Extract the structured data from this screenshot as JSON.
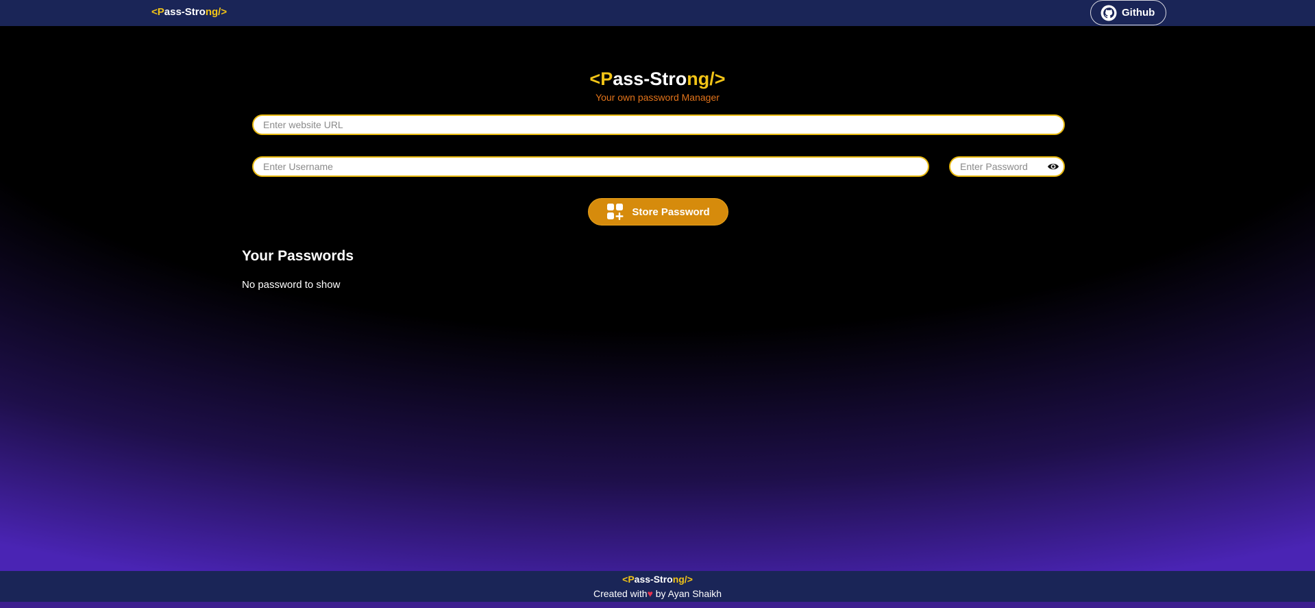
{
  "nav": {
    "logo": {
      "open": "<",
      "p": "P",
      "a": "a",
      "ss": "ss-Stro",
      "ng": "ng/",
      "close": ">"
    },
    "github_label": "Github"
  },
  "hero": {
    "title": {
      "open": "<",
      "p": "P",
      "a": "a",
      "ss": "ss-Stro",
      "ng": "ng/",
      "close": ">"
    },
    "subtitle": "Your own password Manager"
  },
  "form": {
    "url_placeholder": "Enter website URL",
    "username_placeholder": "Enter Username",
    "password_placeholder": "Enter Password",
    "store_label": "Store Password"
  },
  "passwords": {
    "heading": "Your Passwords",
    "empty_message": "No password to show"
  },
  "footer": {
    "logo": {
      "open": "<",
      "p": "P",
      "a": "a",
      "ss": "ss-Stro",
      "ng": "ng/",
      "close": ">"
    },
    "credit_prefix": "Created with",
    "heart": "♥",
    "credit_suffix": " by Ayan Shaikh"
  },
  "colors": {
    "accent_yellow": "#f2c417",
    "accent_orange": "#d68b0c",
    "nav_bg": "#1a2557",
    "subtitle": "#e2731a"
  }
}
